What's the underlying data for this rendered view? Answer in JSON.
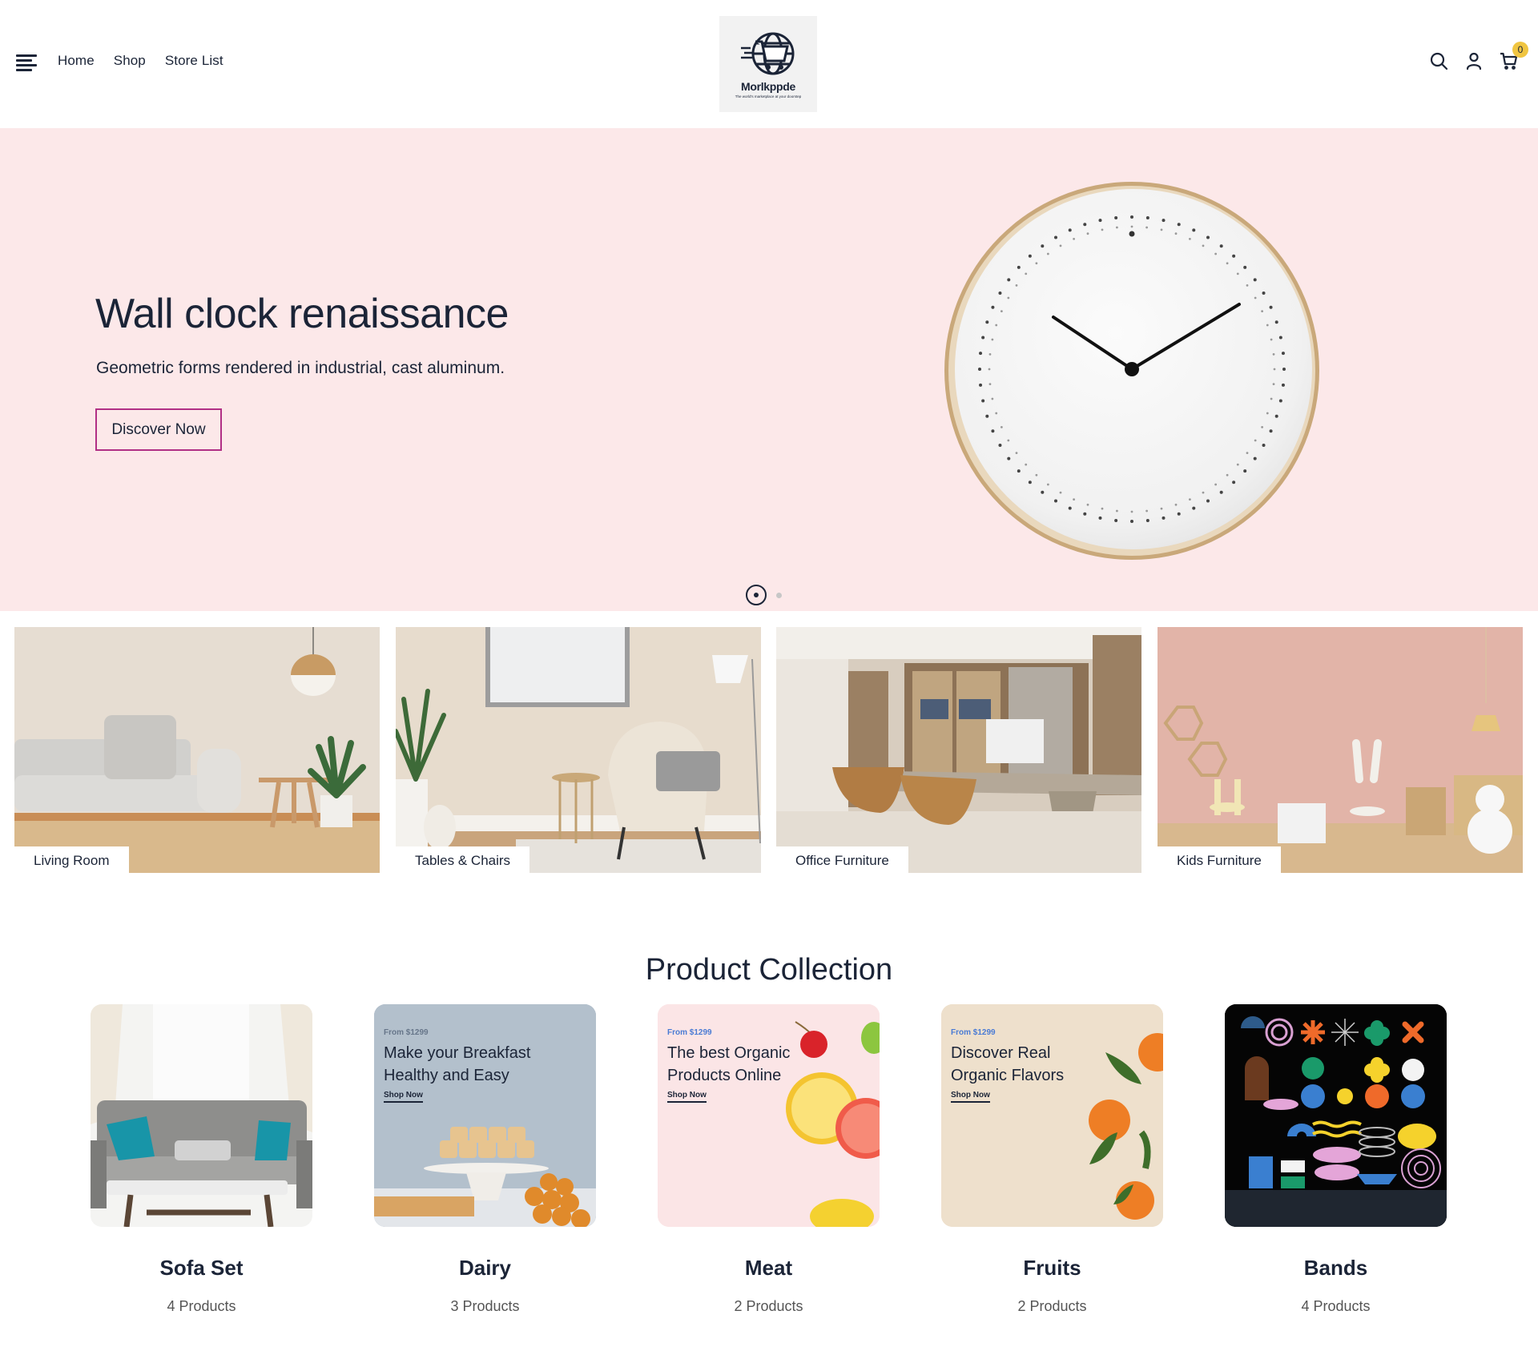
{
  "header": {
    "menu_icon": "hamburger-menu-icon",
    "nav": [
      {
        "label": "Home"
      },
      {
        "label": "Shop"
      },
      {
        "label": "Store List"
      }
    ],
    "logo": {
      "name": "Morlkppde",
      "tagline": "The world's marketplace at your doorstep",
      "icon": "globe-cart-icon"
    },
    "icons": [
      "search-icon",
      "user-icon",
      "cart-icon"
    ],
    "cart_count": "0",
    "badge_color": "#f0c541"
  },
  "hero": {
    "title": "Wall clock renaissance",
    "subtitle": "Geometric forms rendered in industrial, cast aluminum.",
    "button_label": "Discover Now",
    "background": "#fce8e9",
    "button_border": "#b12f85",
    "slide_count": 2,
    "active_slide": 1
  },
  "categories": [
    {
      "label": "Living Room"
    },
    {
      "label": "Tables & Chairs"
    },
    {
      "label": "Office Furniture"
    },
    {
      "label": "Kids Furniture"
    }
  ],
  "collection": {
    "title": "Product Collection",
    "items": [
      {
        "name": "Sofa Set",
        "count": "4 Products"
      },
      {
        "name": "Dairy",
        "count": "3 Products",
        "promo": {
          "price": "From $1299",
          "line1": "Make your Breakfast",
          "line2": "Healthy and Easy",
          "link": "Shop Now"
        }
      },
      {
        "name": "Meat",
        "count": "2 Products",
        "promo": {
          "price": "From $1299",
          "line1": "The best Organic",
          "line2": "Products Online",
          "link": "Shop Now"
        }
      },
      {
        "name": "Fruits",
        "count": "2 Products",
        "promo": {
          "price": "From $1299",
          "line1": "Discover Real",
          "line2": "Organic Flavors",
          "link": "Shop Now"
        }
      },
      {
        "name": "Bands",
        "count": "4 Products"
      }
    ]
  }
}
